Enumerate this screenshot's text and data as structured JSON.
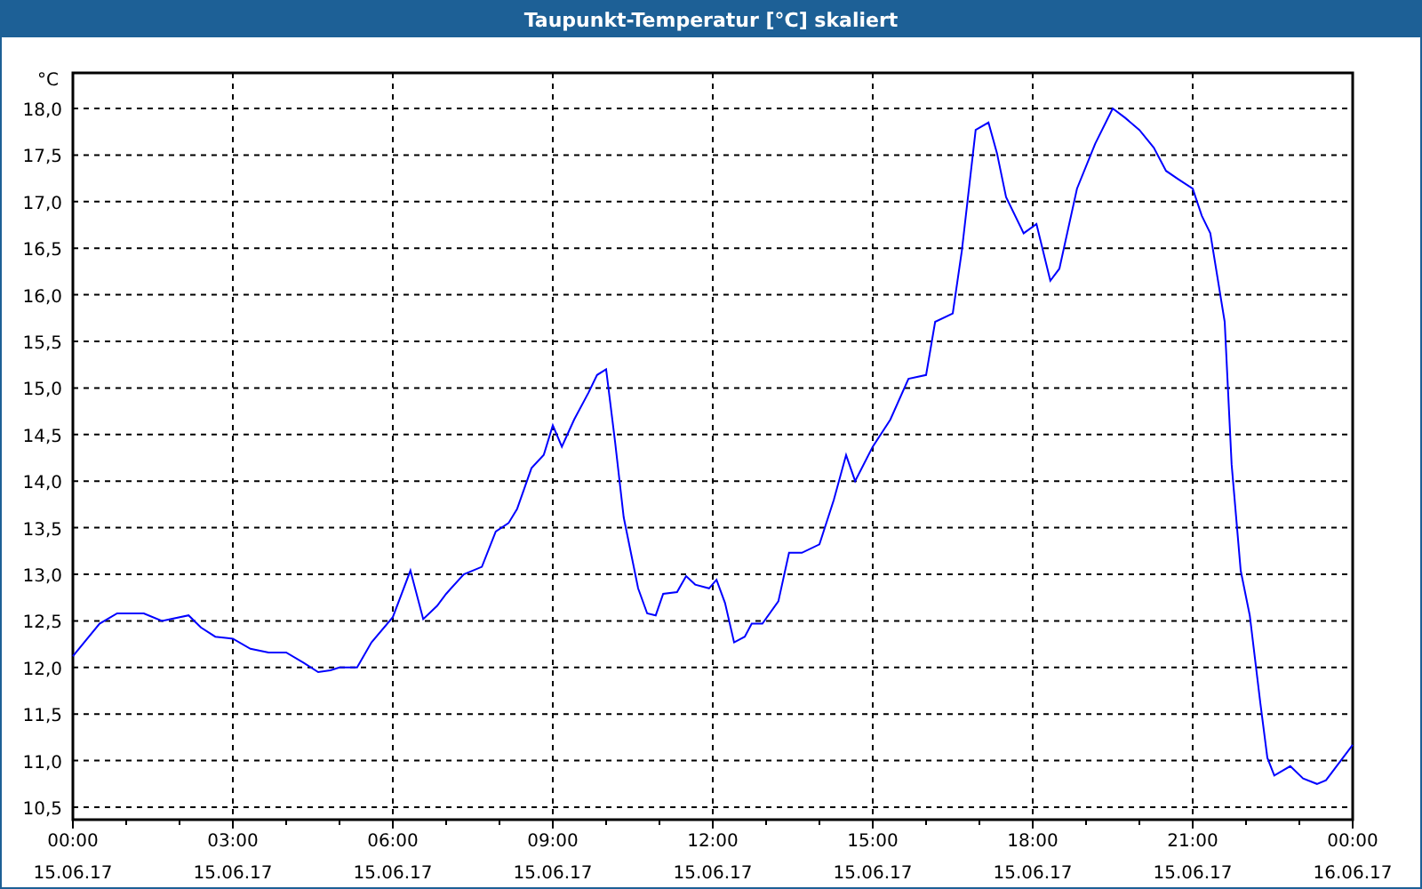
{
  "chart": {
    "x_axis_dates": [
      "15.06.17",
      "15.06.17",
      "15.06.17",
      "15.06.17",
      "15.06.17",
      "15.06.17",
      "15.06.17",
      "15.06.17",
      "16.06.17"
    ],
    "chart_data": {
      "type": "line",
      "grid": true,
      "title": "Taupunkt-Temperatur [°C] skaliert",
      "ylabel": "°C",
      "xlim": [
        0,
        24
      ],
      "ylim": [
        10.5,
        18.0
      ],
      "xticks": [
        {
          "value": 0,
          "label": "00:00"
        },
        {
          "value": 3,
          "label": "03:00"
        },
        {
          "value": 6,
          "label": "06:00"
        },
        {
          "value": 9,
          "label": "09:00"
        },
        {
          "value": 12,
          "label": "12:00"
        },
        {
          "value": 15,
          "label": "15:00"
        },
        {
          "value": 18,
          "label": "18:00"
        },
        {
          "value": 21,
          "label": "21:00"
        },
        {
          "value": 24,
          "label": "00:00"
        }
      ],
      "yticks": [
        {
          "value": 10.5,
          "label": "10,5"
        },
        {
          "value": 11,
          "label": "11,0"
        },
        {
          "value": 11.5,
          "label": "11,5"
        },
        {
          "value": 12,
          "label": "12,0"
        },
        {
          "value": 12.5,
          "label": "12,5"
        },
        {
          "value": 13,
          "label": "13,0"
        },
        {
          "value": 13.5,
          "label": "13,5"
        },
        {
          "value": 14,
          "label": "14,0"
        },
        {
          "value": 14.5,
          "label": "14,5"
        },
        {
          "value": 15,
          "label": "15,0"
        },
        {
          "value": 15.5,
          "label": "15,5"
        },
        {
          "value": 16,
          "label": "16,0"
        },
        {
          "value": 16.5,
          "label": "16,5"
        },
        {
          "value": 17,
          "label": "17,0"
        },
        {
          "value": 17.5,
          "label": "17,5"
        },
        {
          "value": 18,
          "label": "18,0"
        }
      ],
      "x": [
        0,
        0.5,
        0.83,
        1.33,
        1.67,
        2.17,
        2.4,
        2.67,
        3,
        3.33,
        3.67,
        4,
        4.33,
        4.6,
        4.83,
        5,
        5.33,
        5.6,
        6,
        6.33,
        6.57,
        6.83,
        7,
        7.33,
        7.67,
        7.93,
        8.17,
        8.33,
        8.6,
        8.83,
        9,
        9.17,
        9.4,
        9.67,
        9.83,
        10,
        10.17,
        10.33,
        10.6,
        10.77,
        10.93,
        11.07,
        11.33,
        11.5,
        11.67,
        11.93,
        12.07,
        12.23,
        12.4,
        12.6,
        12.73,
        12.93,
        13.23,
        13.43,
        13.67,
        14.0,
        14.27,
        14.5,
        14.67,
        15,
        15.33,
        15.67,
        16,
        16.17,
        16.5,
        16.67,
        16.93,
        17.17,
        17.33,
        17.5,
        17.83,
        18.07,
        18.33,
        18.5,
        18.83,
        19.17,
        19.5,
        19.73,
        20,
        20.27,
        20.5,
        20.73,
        21,
        21.17,
        21.33,
        21.6,
        21.73,
        21.9,
        22.07,
        22.27,
        22.4,
        22.53,
        22.83,
        23.07,
        23.33,
        23.5,
        24
      ],
      "series": [
        {
          "color": "#0000ff",
          "values": [
            12.12,
            12.47,
            12.58,
            12.58,
            12.5,
            12.56,
            12.43,
            12.33,
            12.31,
            12.2,
            12.16,
            12.16,
            12.05,
            11.95,
            11.97,
            12.0,
            12.0,
            12.27,
            12.54,
            13.04,
            12.52,
            12.66,
            12.79,
            13.0,
            13.08,
            13.46,
            13.55,
            13.7,
            14.14,
            14.28,
            14.6,
            14.37,
            14.66,
            14.95,
            15.14,
            15.2,
            14.41,
            13.61,
            12.85,
            12.58,
            12.56,
            12.79,
            12.81,
            12.98,
            12.89,
            12.85,
            12.94,
            12.69,
            12.27,
            12.33,
            12.47,
            12.47,
            12.71,
            13.23,
            13.23,
            13.32,
            13.8,
            14.28,
            14.0,
            14.37,
            14.66,
            15.1,
            15.14,
            15.71,
            15.8,
            16.47,
            17.77,
            17.85,
            17.52,
            17.05,
            16.66,
            16.76,
            16.15,
            16.28,
            17.14,
            17.62,
            18.0,
            17.9,
            17.77,
            17.58,
            17.33,
            17.24,
            17.14,
            16.85,
            16.66,
            15.71,
            14.18,
            13.04,
            12.56,
            11.61,
            11.03,
            10.84,
            10.94,
            10.81,
            10.75,
            10.79,
            11.17
          ]
        }
      ]
    }
  }
}
